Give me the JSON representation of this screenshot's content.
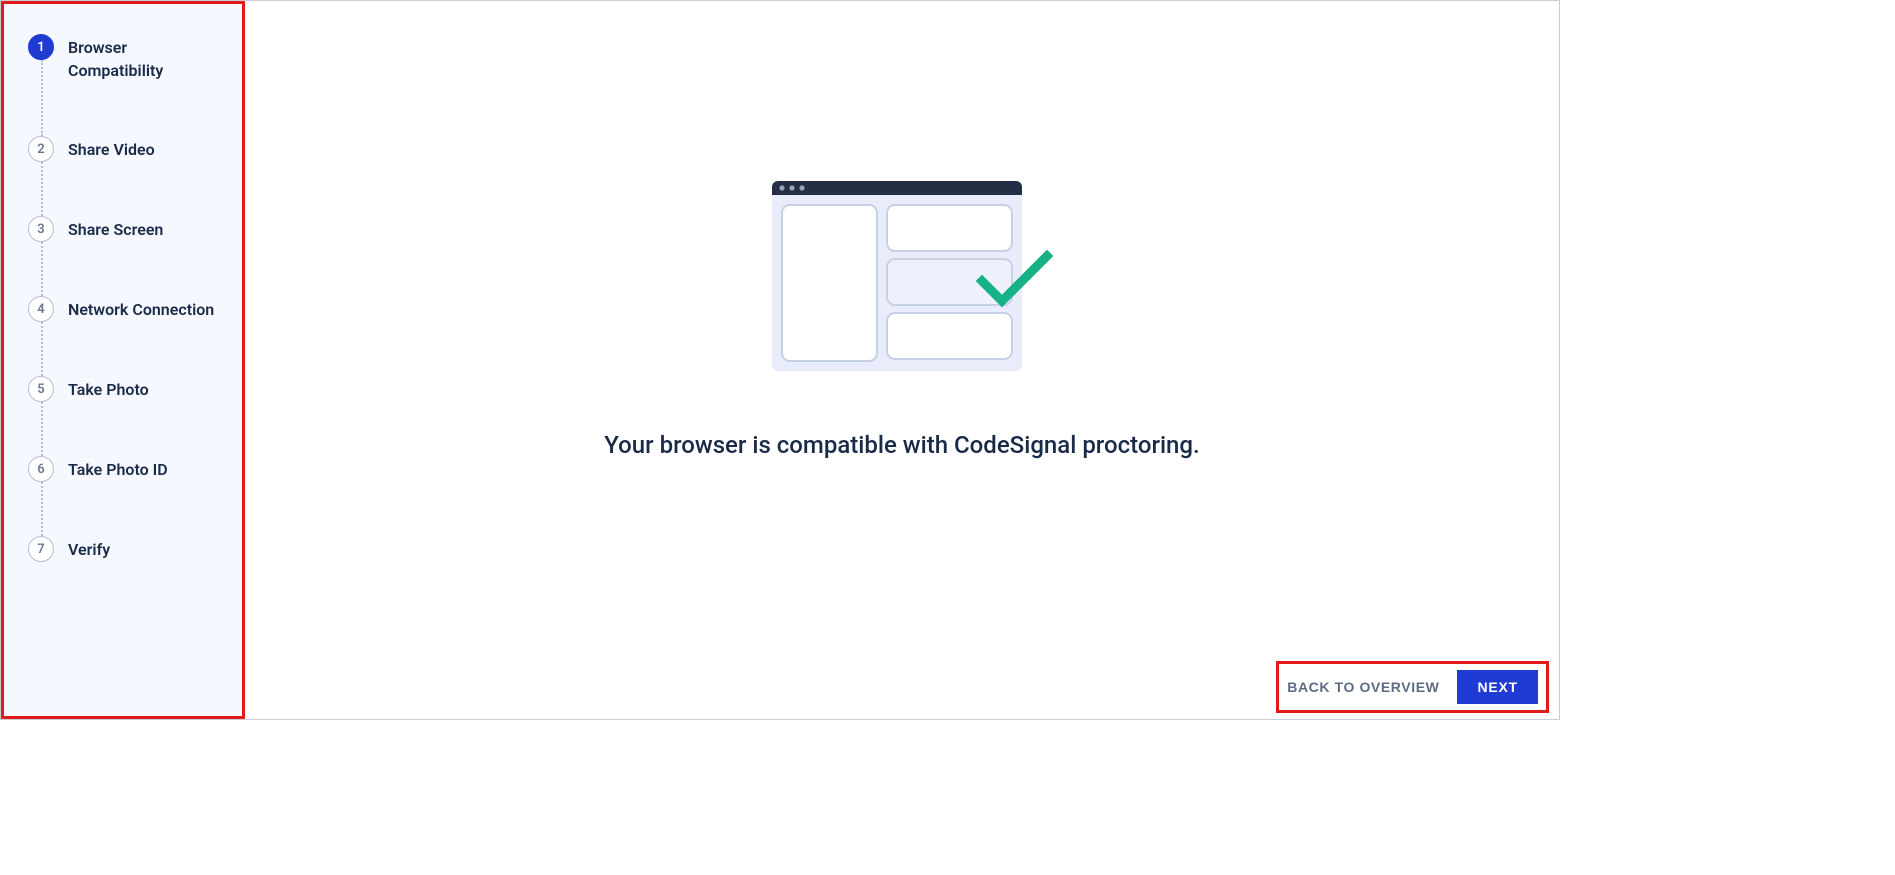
{
  "sidebar": {
    "steps": [
      {
        "num": "1",
        "label": "Browser Compatibility",
        "active": true
      },
      {
        "num": "2",
        "label": "Share Video",
        "active": false
      },
      {
        "num": "3",
        "label": "Share Screen",
        "active": false
      },
      {
        "num": "4",
        "label": "Network Connection",
        "active": false
      },
      {
        "num": "5",
        "label": "Take Photo",
        "active": false
      },
      {
        "num": "6",
        "label": "Take Photo ID",
        "active": false
      },
      {
        "num": "7",
        "label": "Verify",
        "active": false
      }
    ]
  },
  "main": {
    "headline": "Your browser is compatible with CodeSignal proctoring."
  },
  "footer": {
    "back_label": "BACK TO OVERVIEW",
    "next_label": "NEXT"
  },
  "colors": {
    "accent": "#1f3bd1",
    "highlight_border": "#e11a1a",
    "check": "#16b187",
    "illus_bg": "#e8ecfb",
    "illus_bar": "#242f45"
  }
}
